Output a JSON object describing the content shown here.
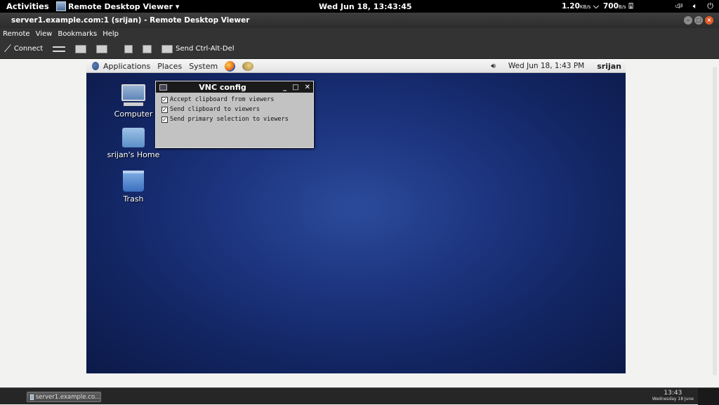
{
  "topbar": {
    "activities": "Activities",
    "app_name": "Remote Desktop Viewer ▾",
    "clock": "Wed Jun 18, 13:43:45",
    "net_down": "1.20",
    "net_down_unit": "KB/s",
    "net_up": "700",
    "net_up_unit": "B/s",
    "glyph": "ঞ"
  },
  "window": {
    "title": "server1.example.com:1 (srijan) - Remote Desktop Viewer"
  },
  "menubar": [
    "Remote",
    "View",
    "Bookmarks",
    "Help"
  ],
  "toolbar": {
    "connect": "Connect",
    "send_cad": "Send Ctrl-Alt-Del"
  },
  "remote": {
    "panel": {
      "applications": "Applications",
      "places": "Places",
      "system": "System",
      "datetime": "Wed Jun 18,  1:43 PM",
      "user": "srijan"
    },
    "desktop_icons": {
      "computer": "Computer",
      "home": "srijan's Home",
      "trash": "Trash"
    },
    "vnc_dialog": {
      "title": "VNC config",
      "options": [
        "Accept clipboard from viewers",
        "Send clipboard to viewers",
        "Send primary selection to viewers"
      ]
    }
  },
  "taskbar": {
    "item": "server1.example.co...",
    "time": "13:43",
    "date": "Wednesday 18 June"
  }
}
